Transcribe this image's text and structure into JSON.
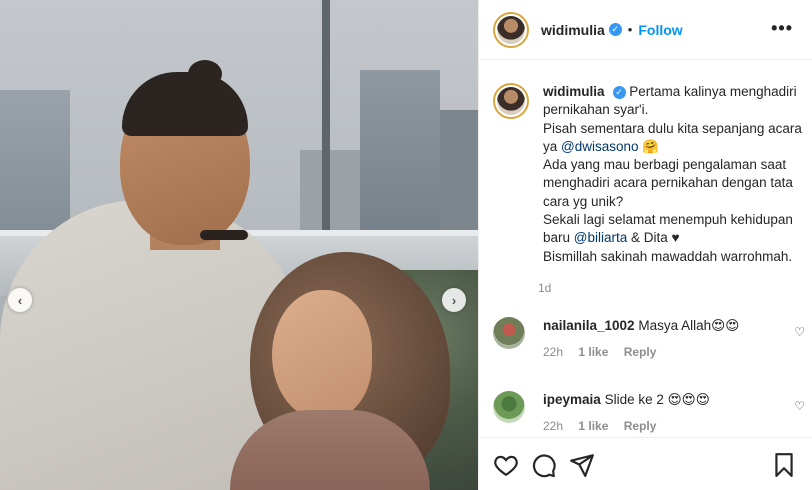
{
  "post": {
    "username": "widimulia",
    "follow_label": "Follow",
    "dot": "•",
    "more_label": "•••"
  },
  "caption": {
    "username": "widimulia",
    "line1": "Pertama kalinya menghadiri pernikahan syar'i.",
    "line2_pre": "Pisah sementara dulu kita sepanjang acara ya ",
    "line2_mention": "@dwisasono",
    "line2_post": " 🤗",
    "line3": "Ada yang mau berbagi pengalaman saat menghadiri acara pernikahan dengan tata cara yg unik?",
    "line4_pre": "Sekali lagi selamat menempuh kehidupan baru ",
    "line4_mention": "@biliarta",
    "line4_post": " & Dita ♥",
    "line5": "Bismillah sakinah mawaddah warrohmah.",
    "time": "1d"
  },
  "comments": [
    {
      "username": "nailanila_1002",
      "text": "Masya Allah😍😍",
      "time": "22h",
      "likes": "1 like",
      "reply": "Reply"
    },
    {
      "username": "ipeymaia",
      "text": "Slide ke 2 😍😍😍",
      "time": "22h",
      "likes": "1 like",
      "reply": "Reply"
    }
  ],
  "icons": {
    "verified": "verified-badge-icon",
    "carousel_prev": "chevron-left-icon",
    "carousel_next": "chevron-right-icon",
    "like": "heart-icon",
    "comment": "comment-icon",
    "share": "paper-plane-icon",
    "save": "bookmark-icon"
  },
  "colors": {
    "accent": "#0095f6",
    "verified": "#3897f0",
    "mention": "#00376b",
    "muted": "#8e8e8e"
  }
}
